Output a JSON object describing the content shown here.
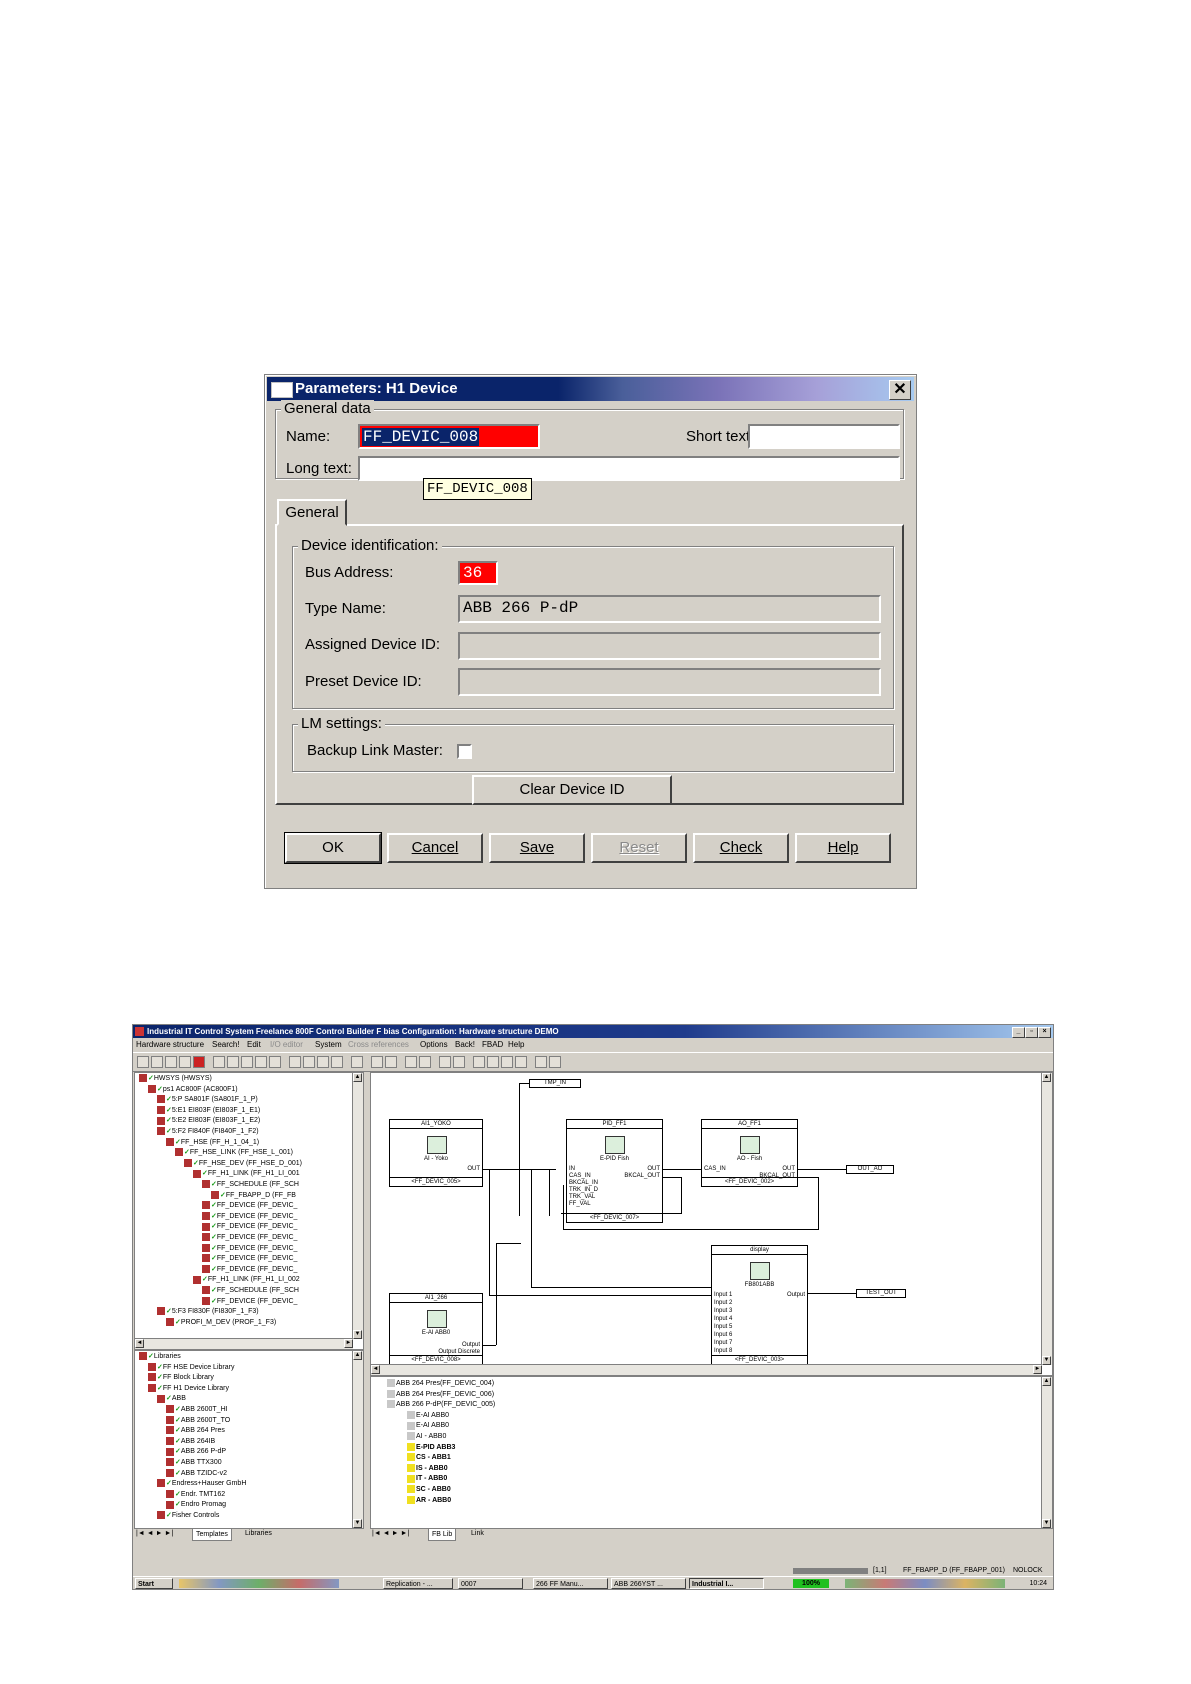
{
  "dialog": {
    "title": "Parameters: H1 Device",
    "close_label": "✕",
    "general_data": {
      "label": "General data",
      "name_label": "Name:",
      "name_value": "FF_DEVIC_008",
      "short_text_label": "Short text:",
      "short_text_value": "",
      "long_text_label": "Long text:",
      "long_text_value": "",
      "tooltip": "FF_DEVIC_008"
    },
    "tab_general": "General",
    "device_identification": {
      "label": "Device identification:",
      "bus_address_label": "Bus Address:",
      "bus_address_value": "36",
      "type_name_label": "Type Name:",
      "type_name_value": "ABB 266 P-dP",
      "assigned_id_label": "Assigned Device ID:",
      "assigned_id_value": "",
      "preset_id_label": "Preset Device ID:",
      "preset_id_value": ""
    },
    "lm_settings": {
      "label": "LM settings:",
      "backup_label": "Backup Link Master:"
    },
    "clear_device_id": "Clear Device ID",
    "buttons": {
      "ok": "OK",
      "cancel": "Cancel",
      "save": "Save",
      "reset": "Reset",
      "check": "Check",
      "help": "Help"
    },
    "colors": {
      "error_field": "#ff0000",
      "selection": "#0a246a"
    }
  },
  "app": {
    "title": "Industrial IT Control System Freelance 800F Control Builder F bias  Configuration: Hardware structure  DEMO",
    "menu": [
      "Hardware structure",
      "Search!",
      "Edit",
      "I/O editor",
      "System",
      "Cross references",
      "Options",
      "Back!",
      "FBAD",
      "Help"
    ],
    "tree_top": [
      "HWSYS (HWSYS)",
      "ps1   AC800F (AC800F1)",
      "5:P  SA801F (SA801F_1_P)",
      "5:E1  EI803F (EI803F_1_E1)",
      "5:E2  EI803F (EI803F_1_E2)",
      "5:F2  FI840F (FI840F_1_F2)",
      "FF_HSE (FF_H_1_04_1)",
      "FF_HSE_LINK (FF_HSE_L_001)",
      "FF_HSE_DEV (FF_HSE_D_001)",
      "FF_H1_LINK (FF_H1_LI_001",
      "FF_SCHEDULE (FF_SCH",
      "FF_FBAPP_D (FF_FB",
      "FF_DEVICE (FF_DEVIC_",
      "FF_DEVICE (FF_DEVIC_",
      "FF_DEVICE (FF_DEVIC_",
      "FF_DEVICE (FF_DEVIC_",
      "FF_DEVICE (FF_DEVIC_",
      "FF_DEVICE (FF_DEVIC_",
      "FF_DEVICE (FF_DEVIC_",
      "FF_H1_LINK (FF_H1_LI_002",
      "FF_SCHEDULE (FF_SCH",
      "FF_DEVICE (FF_DEVIC_",
      "5:F3  FI830F (FI830F_1_F3)",
      "PROFI_M_DEV (PROF_1_F3)"
    ],
    "tree_bottom": [
      "Libraries",
      "FF HSE Device Library",
      "FF Block Library",
      "FF H1 Device Library",
      "ABB",
      "ABB 2600T_HI",
      "ABB 2600T_TO",
      "ABB 264 Pres",
      "ABB 264IB",
      "ABB 266 P-dP",
      "ABB TTX300",
      "ABB TZIDC-v2",
      "Endress+Hauser GmbH",
      "Endr. TMT162",
      "Endro Promag",
      "Fisher Controls"
    ],
    "tree_tabs": [
      "Templates",
      "Libraries"
    ],
    "diagram": {
      "tags": [
        "TMP_IN",
        "OUT_AO",
        "TEST_OUT"
      ],
      "blocks": [
        {
          "title": "AI1_YOKO",
          "name": "AI - Yoko",
          "foot": "<FF_DEVIC_005>",
          "pins_in": [],
          "pins_out": [
            "OUT"
          ]
        },
        {
          "title": "PID_FF1",
          "name": "E-PID Fish",
          "foot": "<FF_DEVIC_007>",
          "pins_in": [
            "IN",
            "CAS_IN",
            "BKCAL_IN",
            "TRK_IN_D",
            "TRK_VAL",
            "FF_VAL"
          ],
          "pins_out": [
            "OUT",
            "BKCAL_OUT"
          ]
        },
        {
          "title": "AO_FF1",
          "name": "AO - Fish",
          "foot": "<FF_DEVIC_002>",
          "pins_in": [
            "CAS_IN"
          ],
          "pins_out": [
            "OUT",
            "BKCAL_OUT"
          ]
        },
        {
          "title": "AI1_266",
          "name": "E-AI ABB0",
          "foot": "<FF_DEVIC_008>",
          "pins_in": [],
          "pins_out": [
            "Output",
            "Output Discrete"
          ]
        },
        {
          "title": "display",
          "name": "FB801ABB",
          "foot": "<FF_DEVIC_003>",
          "pins_in": [
            "Input 1",
            "Input 2",
            "Input 3",
            "Input 4",
            "Input 5",
            "Input 6",
            "Input 7",
            "Input 8"
          ],
          "pins_out": [
            "Output"
          ]
        }
      ]
    },
    "lower_list": [
      "ABB 264 Pres(FF_DEVIC_004)",
      "ABB 264 Pres(FF_DEVIC_006)",
      "ABB 266 P-dP(FF_DEVIC_005)",
      "E-AI ABB0",
      "E-AI ABB0",
      "AI - ABB0",
      "E-PID ABB3",
      "CS - ABB1",
      "IS - ABB0",
      "IT - ABB0",
      "SC - ABB0",
      "AR - ABB0"
    ],
    "lower_tabs": [
      "FB Lib",
      "Link"
    ],
    "status": {
      "pos": "[1,1]",
      "path": "FF_FBAPP_D (FF_FBAPP_001)",
      "lock": "NOLOCK"
    },
    "taskbar": {
      "start": "Start",
      "tasks": [
        "Replication - ...",
        "0007",
        "266 FF Manu...",
        "ABB 266YST ...",
        "Industrial I..."
      ],
      "zoom": "100%",
      "clock": "10:24"
    }
  }
}
